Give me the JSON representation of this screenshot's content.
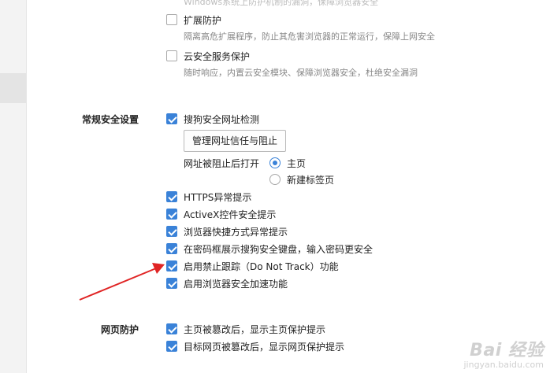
{
  "top_cut_text": "Windows系统上防护机制的漏洞，保障浏览器安全",
  "extension_protect": {
    "label": "扩展防护",
    "desc": "隔离高危扩展程序，防止其危害浏览器的正常运行，保障上网安全",
    "checked": false
  },
  "cloud_protect": {
    "label": "云安全服务保护",
    "desc": "随时响应，内置云安全模块、保障浏览器安全，杜绝安全漏洞",
    "checked": false
  },
  "general_security": {
    "section_label": "常规安全设置",
    "url_check": {
      "label": "搜狗安全网址检测",
      "checked": true
    },
    "manage_button": "管理网址信任与阻止",
    "blocked_open_label": "网址被阻止后打开",
    "radio_options": [
      {
        "label": "主页",
        "selected": true
      },
      {
        "label": "新建标签页",
        "selected": false
      }
    ],
    "options": [
      {
        "label": "HTTPS异常提示",
        "checked": true
      },
      {
        "label": "ActiveX控件安全提示",
        "checked": true
      },
      {
        "label": "浏览器快捷方式异常提示",
        "checked": true
      },
      {
        "label": "在密码框展示搜狗安全键盘，输入密码更安全",
        "checked": true
      },
      {
        "label": "启用禁止跟踪（Do Not Track）功能",
        "checked": true
      },
      {
        "label": "启用浏览器安全加速功能",
        "checked": true
      }
    ]
  },
  "web_protect": {
    "section_label": "网页防护",
    "options": [
      {
        "label": "主页被篡改后，显示主页保护提示",
        "checked": true
      },
      {
        "label": "目标网页被篡改后，显示网页保护提示",
        "checked": true
      }
    ]
  },
  "annotation_arrow": {
    "color": "#e02424"
  },
  "colors": {
    "accent": "#3a82d8"
  },
  "watermark": {
    "logo": "Bai 经验",
    "sub": "jingyan.baidu.com"
  }
}
